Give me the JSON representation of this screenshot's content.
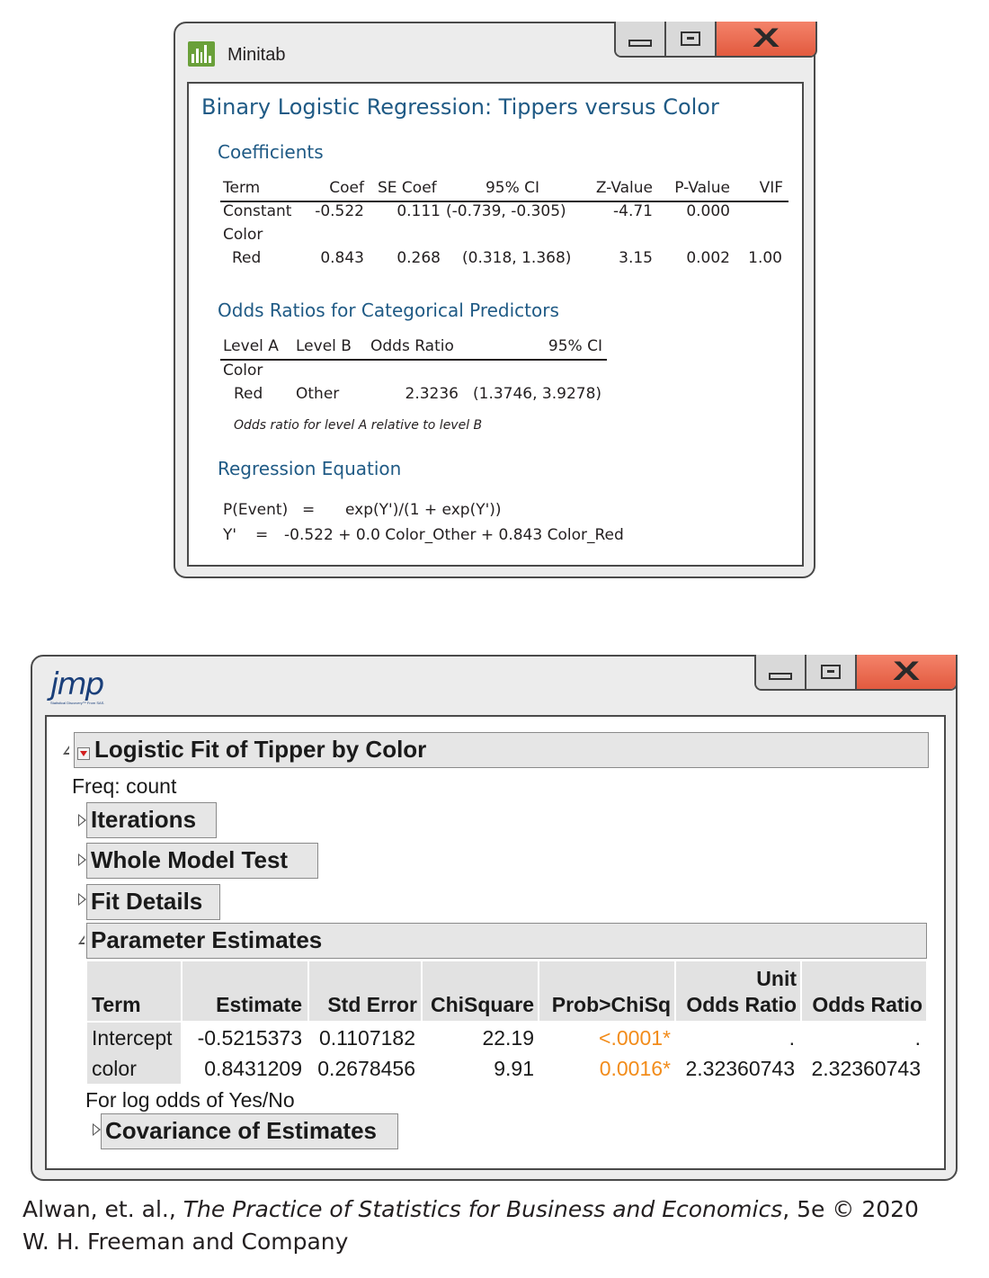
{
  "minitab": {
    "app_title": "Minitab",
    "report_title": "Binary Logistic Regression: Tippers versus Color",
    "coefficients": {
      "heading": "Coefficients",
      "columns": [
        "Term",
        "Coef",
        "SE Coef",
        "95% CI",
        "Z-Value",
        "P-Value",
        "VIF"
      ],
      "rows": [
        {
          "term": "Constant",
          "coef": "-0.522",
          "se_coef": "0.111",
          "ci": "(-0.739, -0.305)",
          "z": "-4.71",
          "p": "0.000",
          "vif": ""
        },
        {
          "term": "Color",
          "coef": "",
          "se_coef": "",
          "ci": "",
          "z": "",
          "p": "",
          "vif": ""
        },
        {
          "term": "Red",
          "coef": "0.843",
          "se_coef": "0.268",
          "ci": "(0.318, 1.368)",
          "z": "3.15",
          "p": "0.002",
          "vif": "1.00"
        }
      ]
    },
    "odds_ratios": {
      "heading": "Odds Ratios for Categorical Predictors",
      "columns": [
        "Level A",
        "Level B",
        "Odds Ratio",
        "95% CI"
      ],
      "group": "Color",
      "row": {
        "level_a": "Red",
        "level_b": "Other",
        "odds_ratio": "2.3236",
        "ci": "(1.3746, 3.9278)"
      },
      "note": "Odds ratio for level A relative to level B"
    },
    "equation": {
      "heading": "Regression Equation",
      "line1_lhs": "P(Event)",
      "line1_eq": "=",
      "line1_rhs": "exp(Y')/(1 + exp(Y'))",
      "line2_lhs": "Y'",
      "line2_eq": "=",
      "line2_rhs": "-0.522 + 0.0 Color_Other + 0.843 Color_Red"
    }
  },
  "jmp": {
    "logo_text": "jmp",
    "logo_sub": "Statistical Discovery™ From SAS.",
    "report_title": "Logistic Fit of Tipper by Color",
    "freq": "Freq: count",
    "sections": {
      "iterations": "Iterations",
      "whole_model": "Whole Model Test",
      "fit_details": "Fit Details",
      "param_estimates": "Parameter Estimates",
      "covariance": "Covariance of Estimates"
    },
    "table": {
      "headers": {
        "term": "Term",
        "estimate": "Estimate",
        "std_error": "Std Error",
        "chisq": "ChiSquare",
        "prob": "Prob>ChiSq",
        "unit_or_top": "Unit",
        "unit_or_bottom": "Odds Ratio",
        "or": "Odds Ratio"
      },
      "rows": [
        {
          "term": "Intercept",
          "estimate": "-0.5215373",
          "std_error": "0.1107182",
          "chisq": "22.19",
          "prob": "<.0001*",
          "unit_or": ".",
          "or": "."
        },
        {
          "term": "color",
          "estimate": "0.8431209",
          "std_error": "0.2678456",
          "chisq": "9.91",
          "prob": "0.0016*",
          "unit_or": "2.32360743",
          "or": "2.32360743"
        }
      ],
      "footnote": "For log odds of Yes/No"
    },
    "colors": {
      "prob_highlight": "#f28c1a"
    }
  },
  "citation": {
    "line1_pre": "Alwan, et. al., ",
    "book": "The Practice of Statistics for Business and Economics",
    "line1_post": ", 5e © 2020",
    "line2": "W. H. Freeman and Company"
  }
}
